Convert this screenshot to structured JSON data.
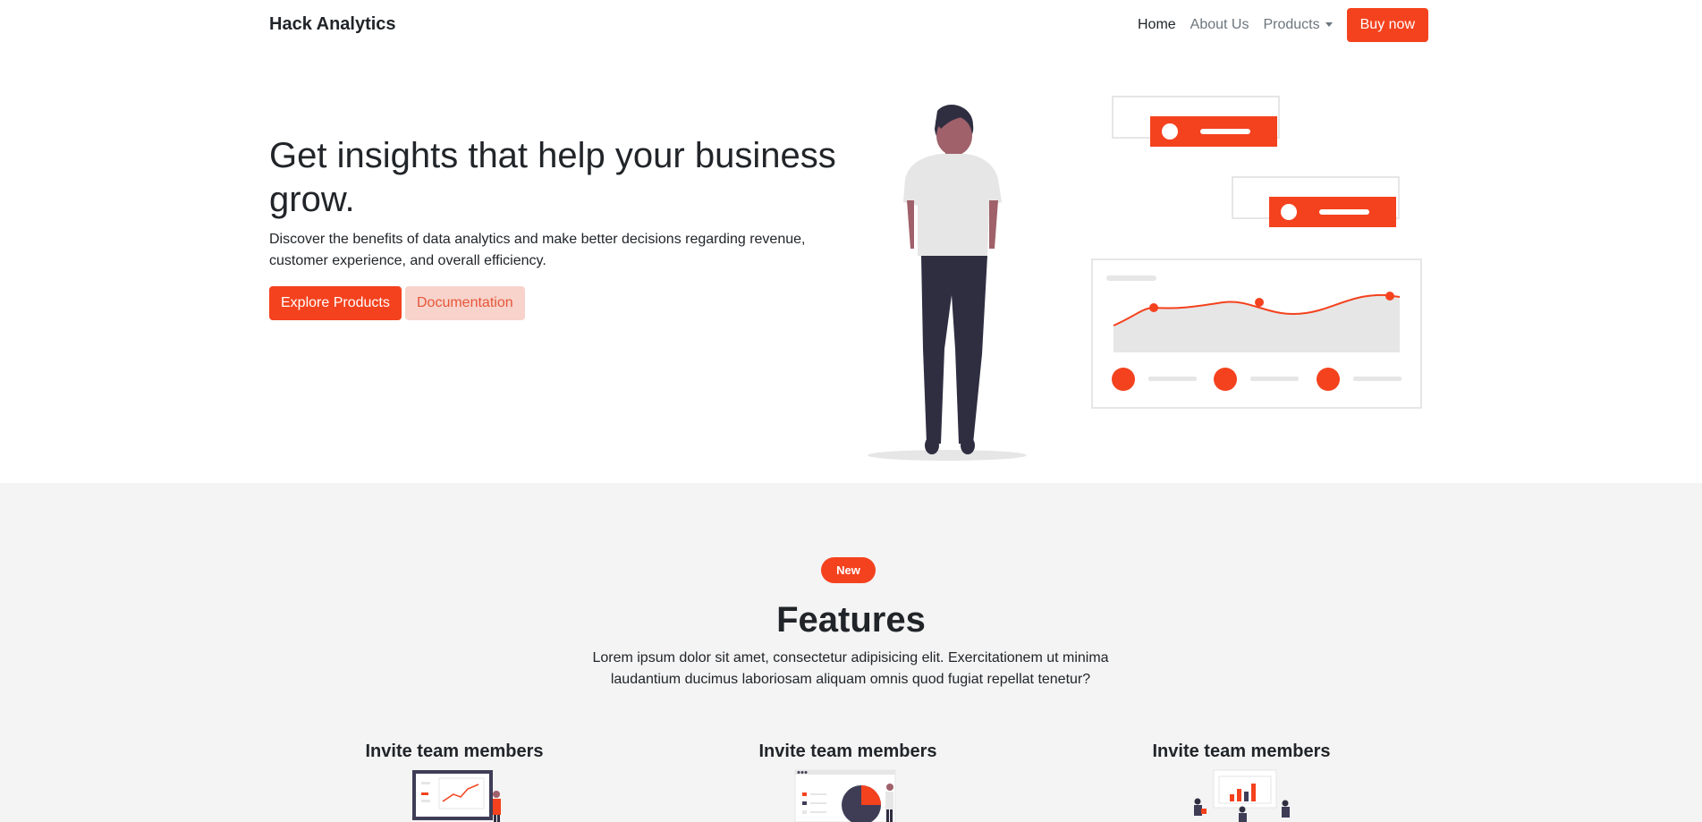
{
  "navbar": {
    "brand": "Hack Analytics",
    "links": [
      {
        "label": "Home",
        "active": true
      },
      {
        "label": "About Us",
        "active": false
      },
      {
        "label": "Products",
        "active": false,
        "dropdown": true
      }
    ],
    "cta": "Buy now"
  },
  "hero": {
    "title": "Get insights that help your business grow.",
    "lead": "Discover the benefits of data analytics and make better decisions regarding revenue, customer experience, and overall efficiency.",
    "primary_button": "Explore Products",
    "secondary_button": "Documentation"
  },
  "features": {
    "badge": "New",
    "title": "Features",
    "lead": "Lorem ipsum dolor sit amet, consectetur adipisicing elit. Exercitationem ut minima laudantium ducimus laboriosam aliquam omnis quod fugiat repellat tenetur?",
    "cards": [
      {
        "title": "Invite team members"
      },
      {
        "title": "Invite team members"
      },
      {
        "title": "Invite team members"
      }
    ]
  },
  "colors": {
    "accent": "#f4421e",
    "accent_light": "#f7d3cb",
    "section_bg": "#f4f4f4",
    "text": "#212529",
    "muted": "#6c757d"
  }
}
